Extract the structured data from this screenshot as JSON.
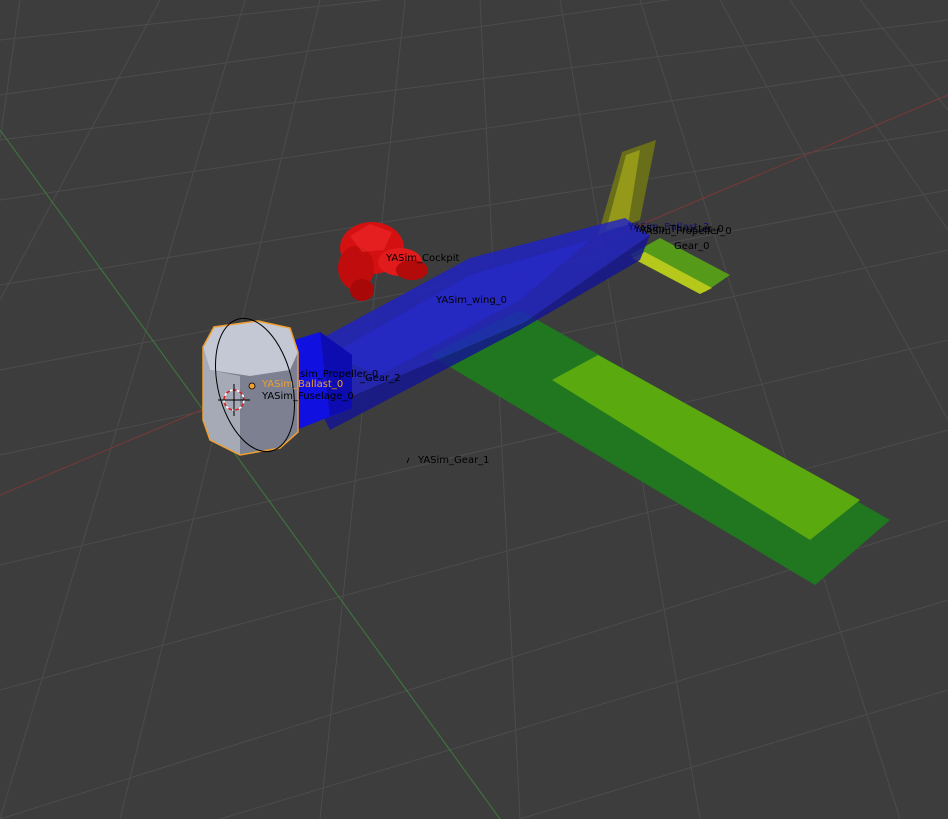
{
  "viewport": {
    "background": "#3d3d3d",
    "grid_color": "#4c4c4c",
    "x_axis_color": "#7a3838",
    "y_axis_color": "#3f7a3f"
  },
  "scene": {
    "colors": {
      "fuselage_top": "#1f21c4",
      "fuselage_bottom": "#14168f",
      "wing_dark": "#1f7a1f",
      "wing_light": "#5aa90e",
      "tail_fin": "#6e7316",
      "cockpit": "#d51010",
      "ballast_light": "#c4c7d4",
      "ballast_dark": "#7c8090",
      "selection": "#f0a030",
      "nose_block": "#1010e0",
      "stab_yellow": "#b6c81c"
    },
    "labels": {
      "cockpit": "YASim_Cockpit",
      "wing": "YASim_wing_0",
      "ballast": "YASim_Ballast_0",
      "fuselage": "YASim_Fuselage_0",
      "gear_1": "YASim_Gear_1",
      "gear_0": "Gear_0",
      "tail_stack_a": "YASim_Ballast_2",
      "tail_stack_b": "YASim_Thruster_0",
      "tail_stack_c": "YASim_Propeller_0",
      "propeller": "sim_Propeller_0",
      "gear_2": "_Gear_2"
    }
  }
}
